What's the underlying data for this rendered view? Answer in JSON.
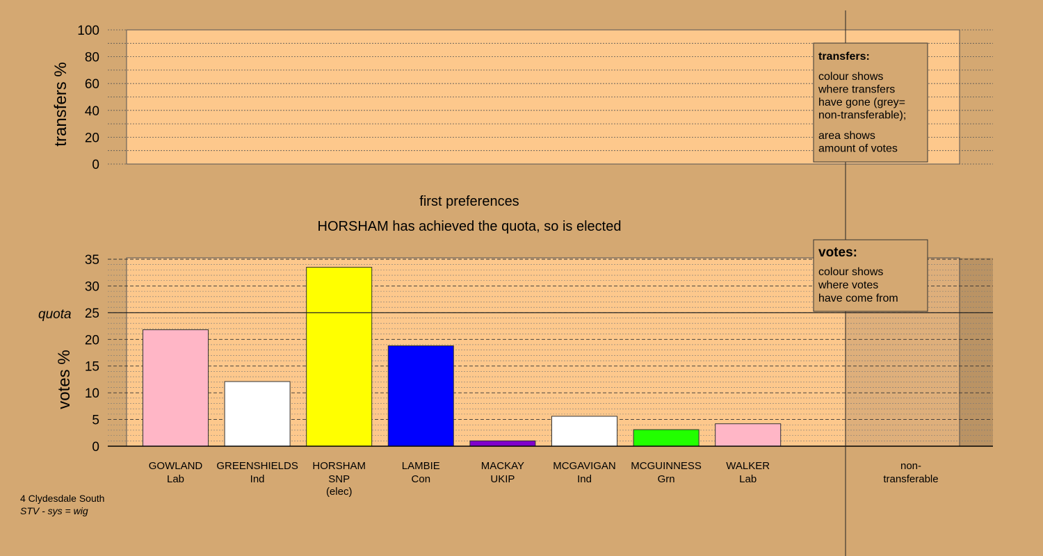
{
  "chart_data": [
    {
      "type": "bar",
      "panel": "transfers",
      "ylabel": "transfers %",
      "ylim": [
        0,
        100
      ],
      "yticks": [
        "0",
        "20",
        "40",
        "60",
        "80",
        "100"
      ],
      "series": [],
      "legend": {
        "title": "transfers:",
        "lines1": [
          "colour shows",
          "where transfers",
          "have gone (grey=",
          "non-transferable);"
        ],
        "lines2": [
          "area shows",
          "amount of votes"
        ]
      }
    },
    {
      "type": "bar",
      "panel": "votes",
      "title": "first preferences",
      "subtitle": "HORSHAM has achieved the quota, so is elected",
      "ylabel": "votes %",
      "ylim": [
        0,
        35
      ],
      "yticks": [
        "0",
        "5",
        "10",
        "15",
        "20",
        "25",
        "30",
        "35"
      ],
      "quota_label": "quota",
      "quota": 25,
      "categories": [
        {
          "name": "GOWLAND",
          "party": "Lab",
          "note": ""
        },
        {
          "name": "GREENSHIELDS",
          "party": "Ind",
          "note": ""
        },
        {
          "name": "HORSHAM",
          "party": "SNP",
          "note": "(elec)"
        },
        {
          "name": "LAMBIE",
          "party": "Con",
          "note": ""
        },
        {
          "name": "MACKAY",
          "party": "UKIP",
          "note": ""
        },
        {
          "name": "MCGAVIGAN",
          "party": "Ind",
          "note": ""
        },
        {
          "name": "MCGUINNESS",
          "party": "Grn",
          "note": ""
        },
        {
          "name": "WALKER",
          "party": "Lab",
          "note": ""
        }
      ],
      "values": [
        21.8,
        12.1,
        33.5,
        18.8,
        1.0,
        5.6,
        3.1,
        4.2
      ],
      "colors": [
        "#ffb6c6",
        "#ffffff",
        "#ffff00",
        "#0000ff",
        "#8000cc",
        "#ffffff",
        "#22ff00",
        "#ffb6c6"
      ],
      "nontransferable_label": [
        "non-",
        "transferable"
      ],
      "nontransferable_value": 0,
      "legend": {
        "title": "votes:",
        "lines": [
          "colour shows",
          "where votes",
          "have come from"
        ]
      }
    }
  ],
  "footer": {
    "line1": "4 Clydesdale South",
    "line2": "STV - sys = wig"
  }
}
